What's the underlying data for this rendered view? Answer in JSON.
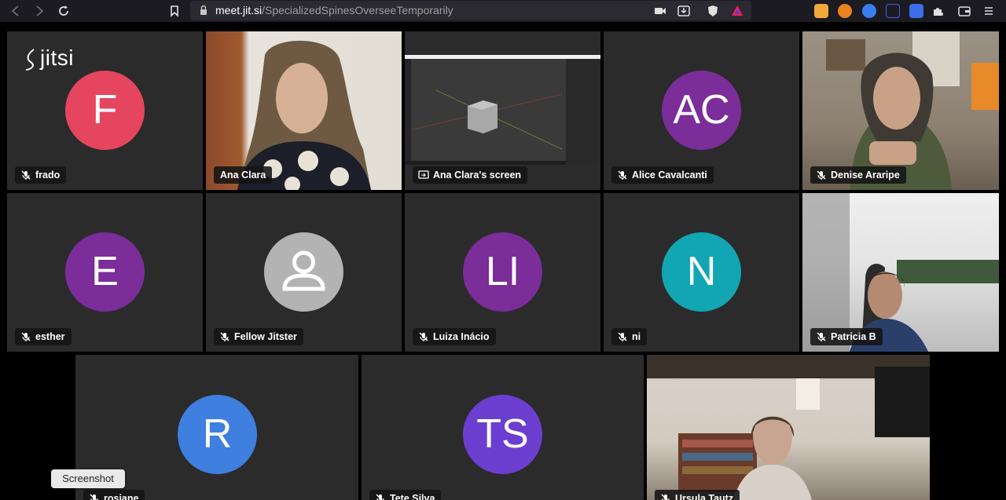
{
  "browser": {
    "url_host": "meet.jit.si",
    "url_path": "/SpecializedSpinesOverseeTemporarily"
  },
  "meeting": {
    "logo_text": "jitsi",
    "tiles": [
      {
        "name": "frado",
        "avatar_initials": "F",
        "avatar_color": "#e6455f",
        "muted": true
      },
      {
        "name": "Ana Clara",
        "video": true,
        "active_speaker": true,
        "muted": false
      },
      {
        "name": "Ana Clara's screen",
        "screen_share": true
      },
      {
        "name": "Alice Cavalcanti",
        "avatar_initials": "AC",
        "avatar_color": "#7b2d99",
        "muted": true
      },
      {
        "name": "Denise Araripe",
        "video": true,
        "muted": true
      },
      {
        "name": "esther",
        "avatar_initials": "E",
        "avatar_color": "#7b2d99",
        "muted": true
      },
      {
        "name": "Fellow Jitster",
        "avatar_icon": "person-icon",
        "avatar_color": "#b3b3b3",
        "muted": true
      },
      {
        "name": "Luiza Inácio",
        "avatar_initials": "LI",
        "avatar_color": "#7b2d99",
        "muted": true
      },
      {
        "name": "ni",
        "avatar_initials": "N",
        "avatar_color": "#12a5b3",
        "muted": true
      },
      {
        "name": "Patricia B",
        "video": true,
        "muted": true
      },
      {
        "name": "rosiane",
        "avatar_initials": "R",
        "avatar_color": "#3e7fe0",
        "muted": true
      },
      {
        "name": "Tete Silva",
        "avatar_initials": "TS",
        "avatar_color": "#6c3ed0",
        "muted": true
      },
      {
        "name": "Ursula Tautz",
        "video": true,
        "muted": true
      }
    ]
  },
  "tooltip": {
    "text": "Screenshot"
  },
  "colors": {
    "active_border": "#3d76d6",
    "tile_bg": "#2b2b2b"
  }
}
